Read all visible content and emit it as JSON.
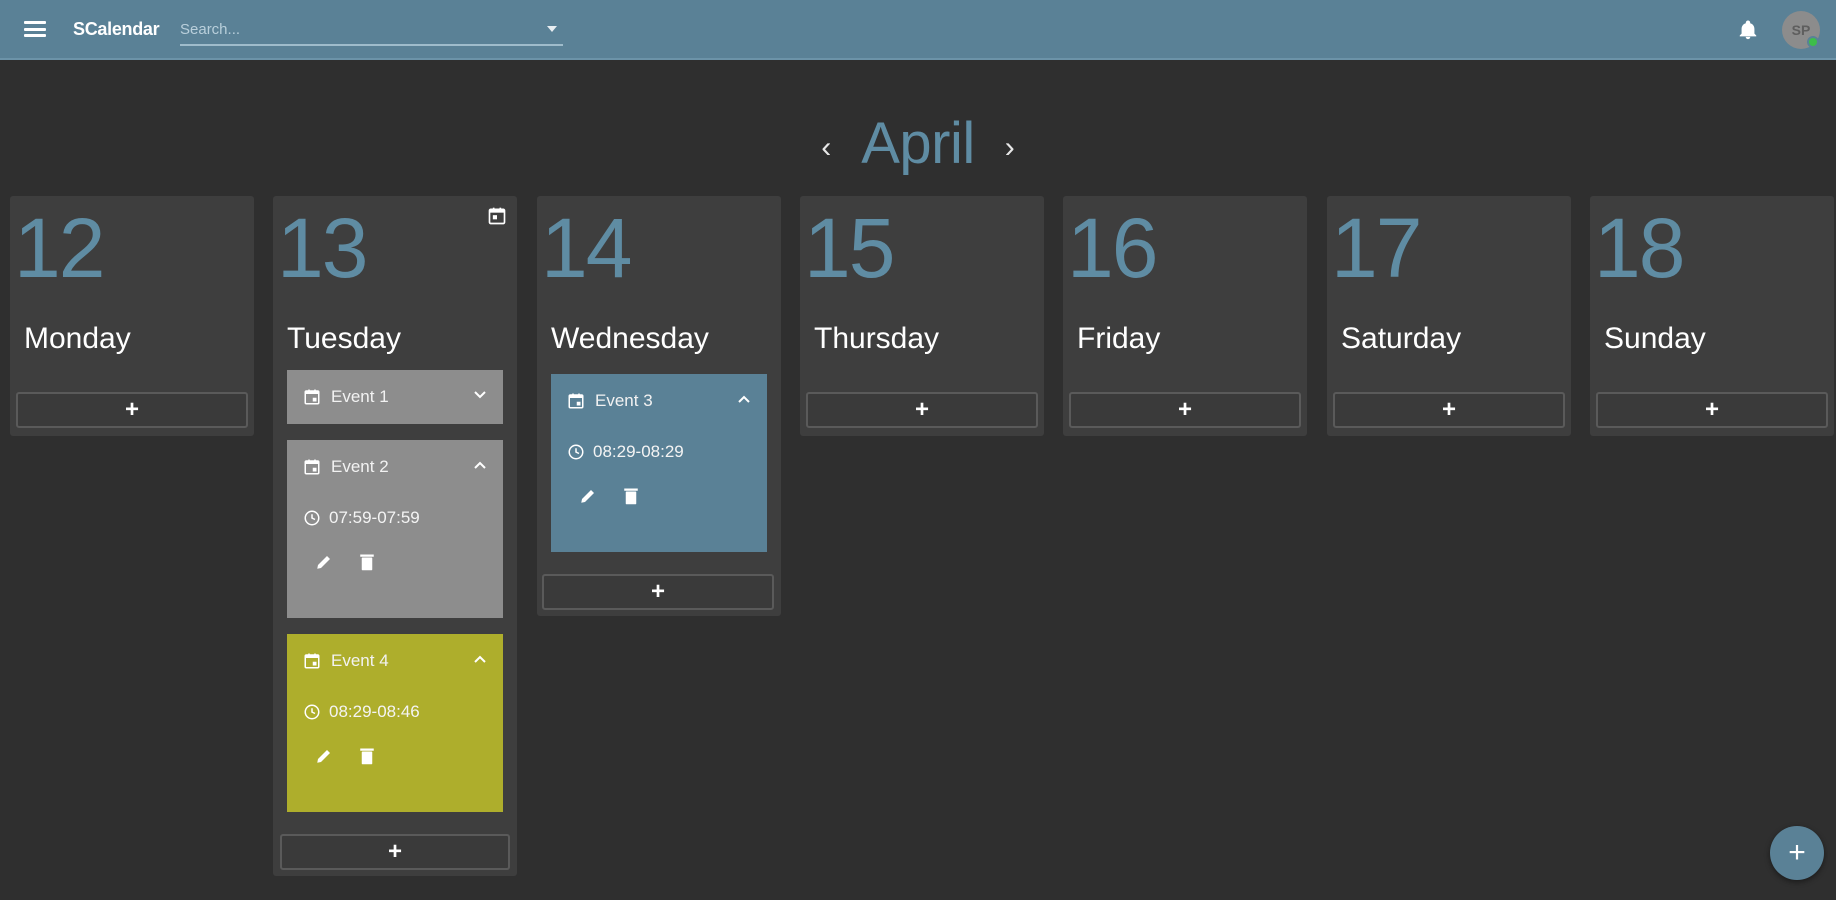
{
  "app": {
    "title": "SCalendar",
    "search_placeholder": "Search..."
  },
  "user": {
    "initials": "SP",
    "status": "online"
  },
  "month": {
    "name": "April",
    "prev_label": "‹",
    "next_label": "›"
  },
  "days": [
    {
      "number": "12",
      "name": "Monday",
      "events": []
    },
    {
      "number": "13",
      "name": "Tuesday",
      "today": true,
      "events": [
        {
          "title": "Event 1",
          "expanded": false,
          "color": "#8d8d8d"
        },
        {
          "title": "Event 2",
          "expanded": true,
          "time": "07:59-07:59",
          "color": "#8d8d8d"
        },
        {
          "title": "Event 4",
          "expanded": true,
          "time": "08:29-08:46",
          "color": "#aeae2c"
        }
      ]
    },
    {
      "number": "14",
      "name": "Wednesday",
      "events": [
        {
          "title": "Event 3",
          "expanded": true,
          "time": "08:29-08:29",
          "color": "#5a8196"
        }
      ]
    },
    {
      "number": "15",
      "name": "Thursday",
      "events": []
    },
    {
      "number": "16",
      "name": "Friday",
      "events": []
    },
    {
      "number": "17",
      "name": "Saturday",
      "events": []
    },
    {
      "number": "18",
      "name": "Sunday",
      "events": []
    }
  ],
  "add_label": "+",
  "fab_label": "+",
  "colors": {
    "topbar": "#5a8196",
    "accent": "#5f8ca3",
    "background": "#2f2f2f",
    "day_card": "#3e3e3e"
  },
  "icons": {
    "menu": "menu-icon",
    "bell": "bell-icon",
    "event": "calendar-icon",
    "time": "clock-icon",
    "edit": "pencil-icon",
    "delete": "trash-icon",
    "today": "today-calendar-icon"
  }
}
